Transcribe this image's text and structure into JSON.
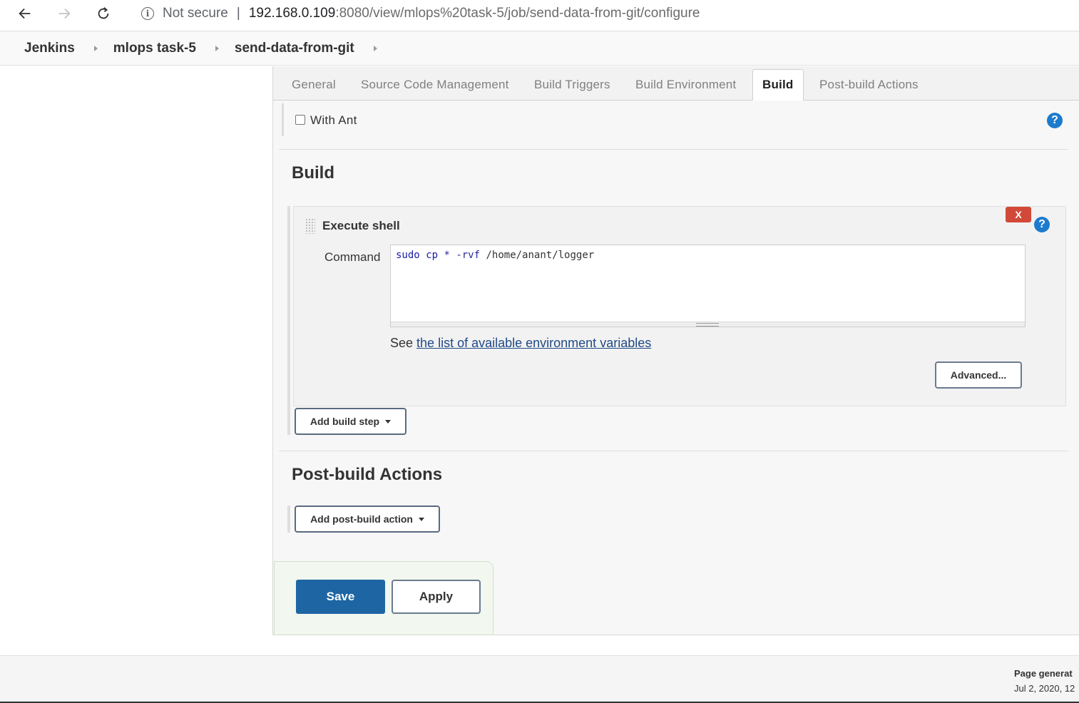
{
  "browser": {
    "security_label": "Not secure",
    "separator": "|",
    "url_host": "192.168.0.109",
    "url_path": ":8080/view/mlops%20task-5/job/send-data-from-git/configure"
  },
  "breadcrumb": {
    "items": [
      "Jenkins",
      "mlops task-5",
      "send-data-from-git"
    ]
  },
  "tabs": [
    "General",
    "Source Code Management",
    "Build Triggers",
    "Build Environment",
    "Build",
    "Post-build Actions"
  ],
  "active_tab": "Build",
  "build_environment": {
    "with_ant_label": "With Ant",
    "with_ant_checked": false
  },
  "build": {
    "section_title": "Build",
    "step": {
      "title": "Execute shell",
      "delete_label": "X",
      "command_label": "Command",
      "command": {
        "cmd": "sudo",
        "sub": "cp",
        "glob": "*",
        "flag": "-rvf",
        "path": "/home/anant/logger"
      },
      "env_prefix": "See",
      "env_link": "the list of available environment variables",
      "advanced_label": "Advanced..."
    },
    "add_step_label": "Add build step"
  },
  "post_build": {
    "section_title": "Post-build Actions",
    "add_action_label": "Add post-build action"
  },
  "actions": {
    "save_label": "Save",
    "apply_label": "Apply"
  },
  "footer": {
    "generated_label": "Page generat",
    "generated_date": "Jul 2, 2020, 12"
  },
  "help_icon_glyph": "?",
  "colors": {
    "save_button": "#1d66a3",
    "delete_button": "#d24939",
    "help_icon": "#1d7bce",
    "link": "#204a87"
  }
}
